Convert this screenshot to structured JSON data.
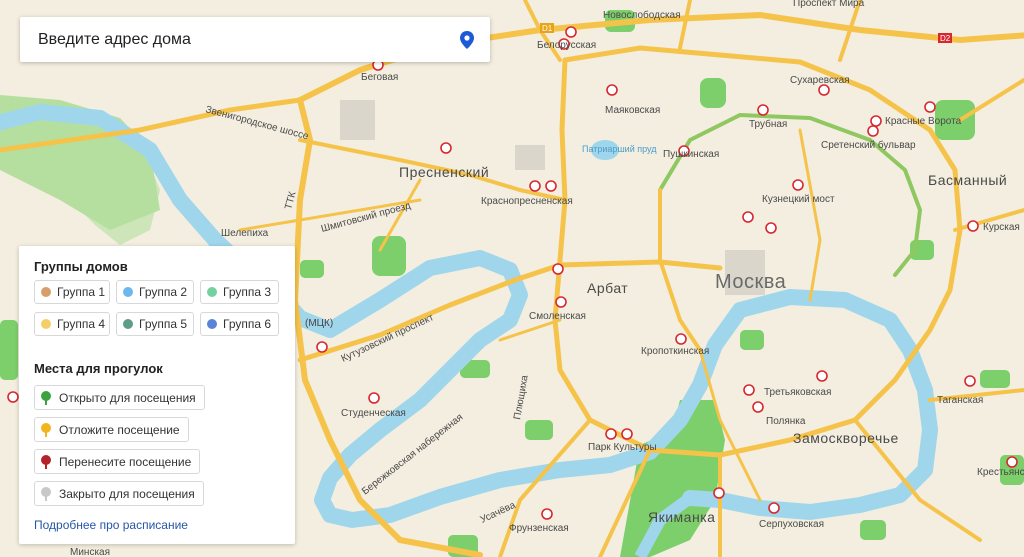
{
  "search": {
    "placeholder": "Введите адрес дома"
  },
  "legend": {
    "groups_title": "Группы домов",
    "groups": [
      {
        "label": "Группа 1",
        "color": "#d79e6b"
      },
      {
        "label": "Группа 2",
        "color": "#6ab8ee"
      },
      {
        "label": "Группа 3",
        "color": "#76d19c"
      },
      {
        "label": "Группа 4",
        "color": "#f4cf68"
      },
      {
        "label": "Группа 5",
        "color": "#5e9e86"
      },
      {
        "label": "Группа 6",
        "color": "#5b84d6"
      }
    ],
    "walks_title": "Места для прогулок",
    "walks": [
      {
        "label": "Открыто для посещения",
        "color": "#3aa33f"
      },
      {
        "label": "Отложите посещение",
        "color": "#f2b51d"
      },
      {
        "label": "Перенесите посещение",
        "color": "#b3232a"
      },
      {
        "label": "Закрыто для посещения",
        "color": "#c8c8c8"
      }
    ],
    "more_link": "Подробнее про расписание"
  },
  "map": {
    "colors": {
      "land": "#f3eedf",
      "water": "#9fd6ec",
      "park": "#7ccf6b",
      "road": "#f6c34a",
      "metro": "#d7282f"
    },
    "districts": [
      "Пресненский",
      "Арбат",
      "Москва",
      "Басманный",
      "Замоскворечье",
      "Якиманка"
    ],
    "stations": [
      "Новослободская",
      "Белорусская",
      "Беговая",
      "Маяковская",
      "Сухаревская",
      "Трубная",
      "Красные Ворота",
      "Сретенский бульвар",
      "Пушкинская",
      "Краснопресненская",
      "Кузнецкий мост",
      "Смоленская",
      "Кропоткинская",
      "Третьяковская",
      "Полянка",
      "Таганская",
      "Парк Культуры",
      "Фрунзенская",
      "Серпуховская",
      "Студенческая",
      "Шелепиха",
      "Курская",
      "Крестьянс",
      "Проспект Мира"
    ],
    "streets": [
      "Звенигородское шоссе",
      "Шмитовский проезд",
      "Кутузовский проспект",
      "Бережковская набережная",
      "Плющиха",
      "Усачёва",
      "Минская",
      "ТТК"
    ],
    "other_labels": [
      "Патриарший пруд",
      "(МЦК)",
      "D1",
      "D2"
    ]
  }
}
